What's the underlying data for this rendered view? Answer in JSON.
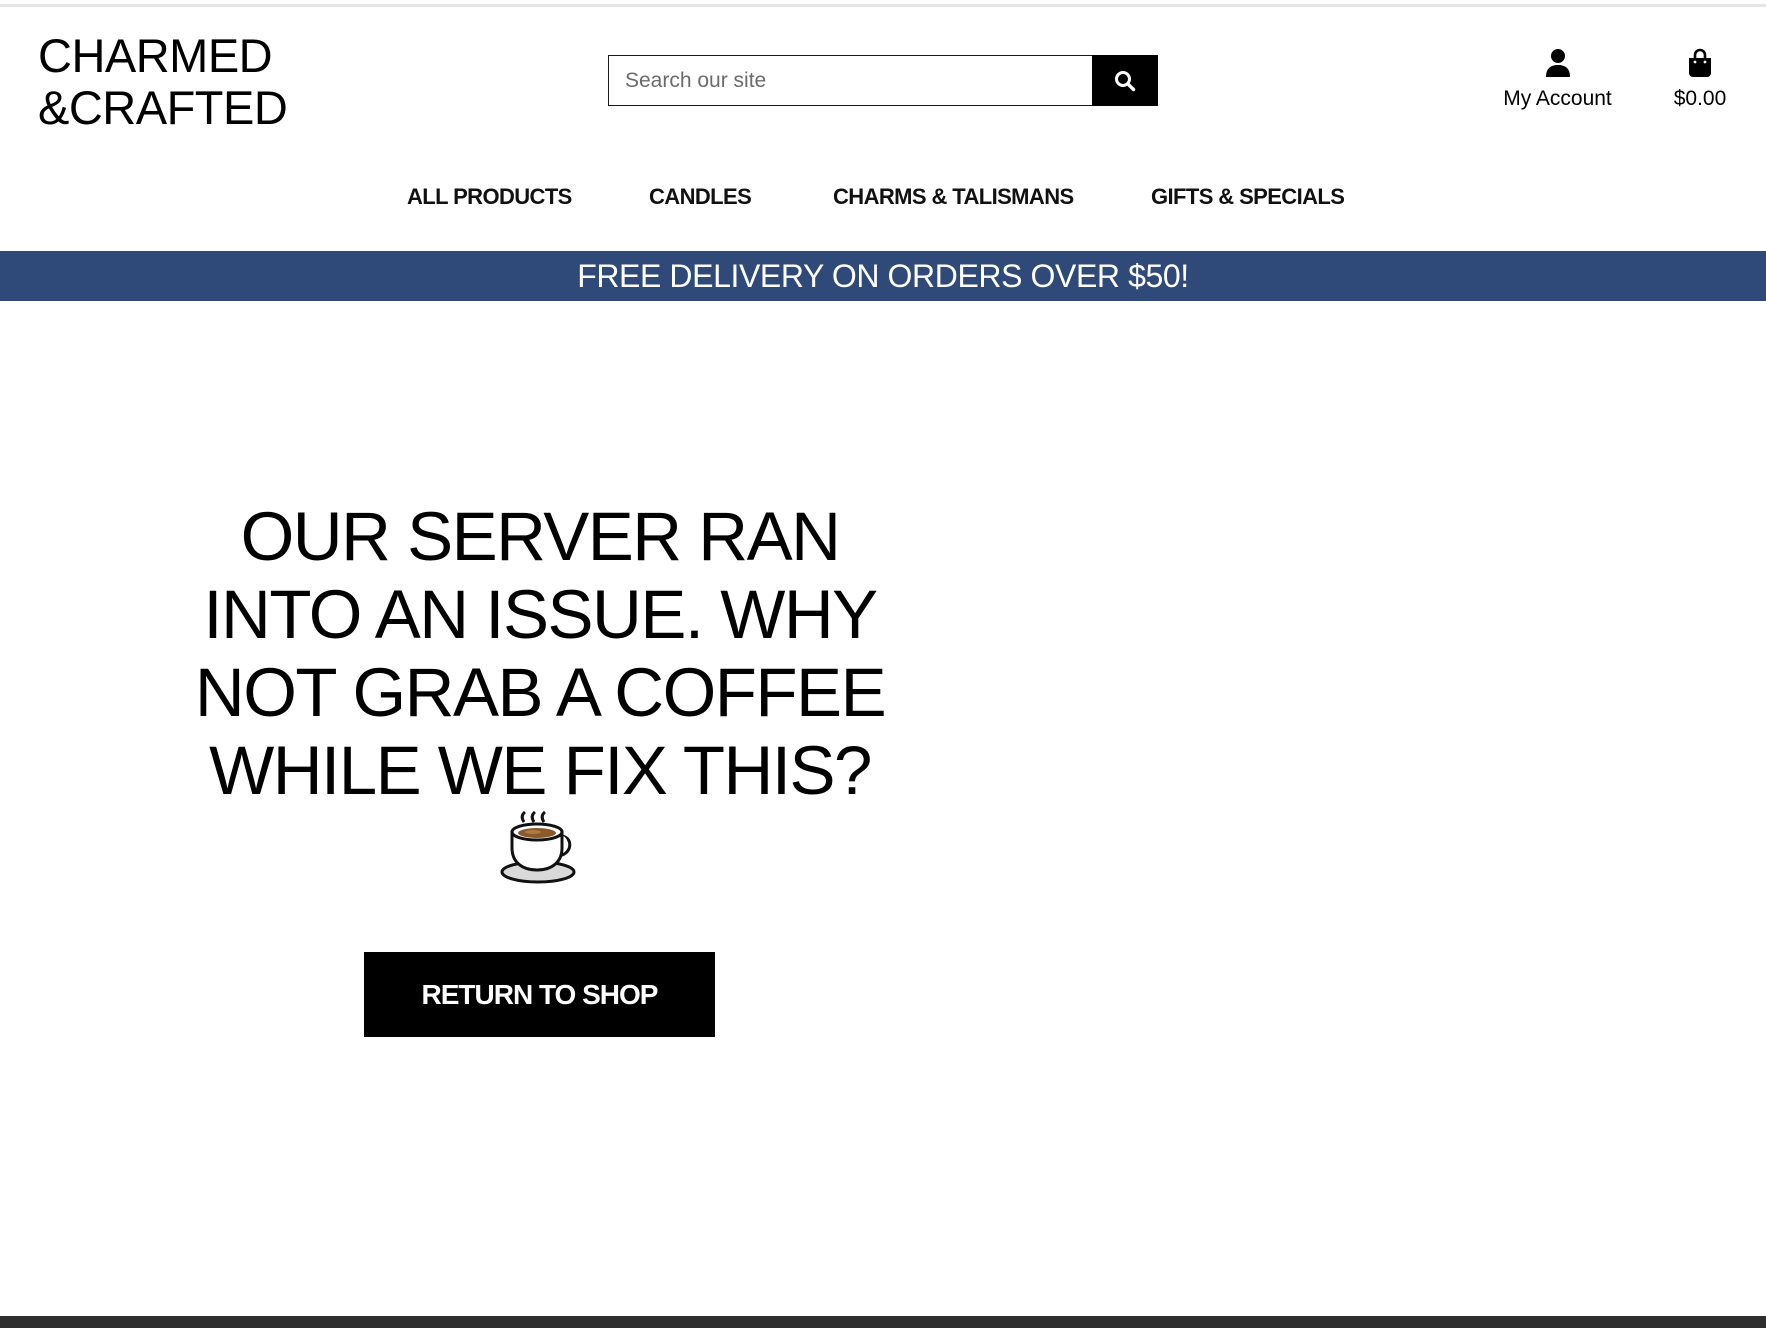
{
  "header": {
    "logo_line1": "CHARMED",
    "logo_line2": "&CRAFTED",
    "search": {
      "placeholder": "Search our site",
      "button_icon": "search-icon"
    },
    "account": {
      "label": "My Account",
      "icon": "user-icon"
    },
    "cart": {
      "label": "$0.00",
      "icon": "shopping-bag-icon"
    }
  },
  "nav": {
    "items": [
      {
        "label": "ALL PRODUCTS"
      },
      {
        "label": "CANDLES"
      },
      {
        "label": "CHARMS & TALISMANS"
      },
      {
        "label": "GIFTS & SPECIALS"
      }
    ]
  },
  "banner": {
    "text": "FREE DELIVERY ON ORDERS OVER $50!",
    "color": "#2f4a79"
  },
  "main": {
    "message": "OUR SERVER RAN INTO AN ISSUE. WHY NOT GRAB A COFFEE WHILE WE FIX THIS?",
    "emoji_icon": "coffee-cup-icon",
    "button_label": "RETURN TO SHOP"
  }
}
